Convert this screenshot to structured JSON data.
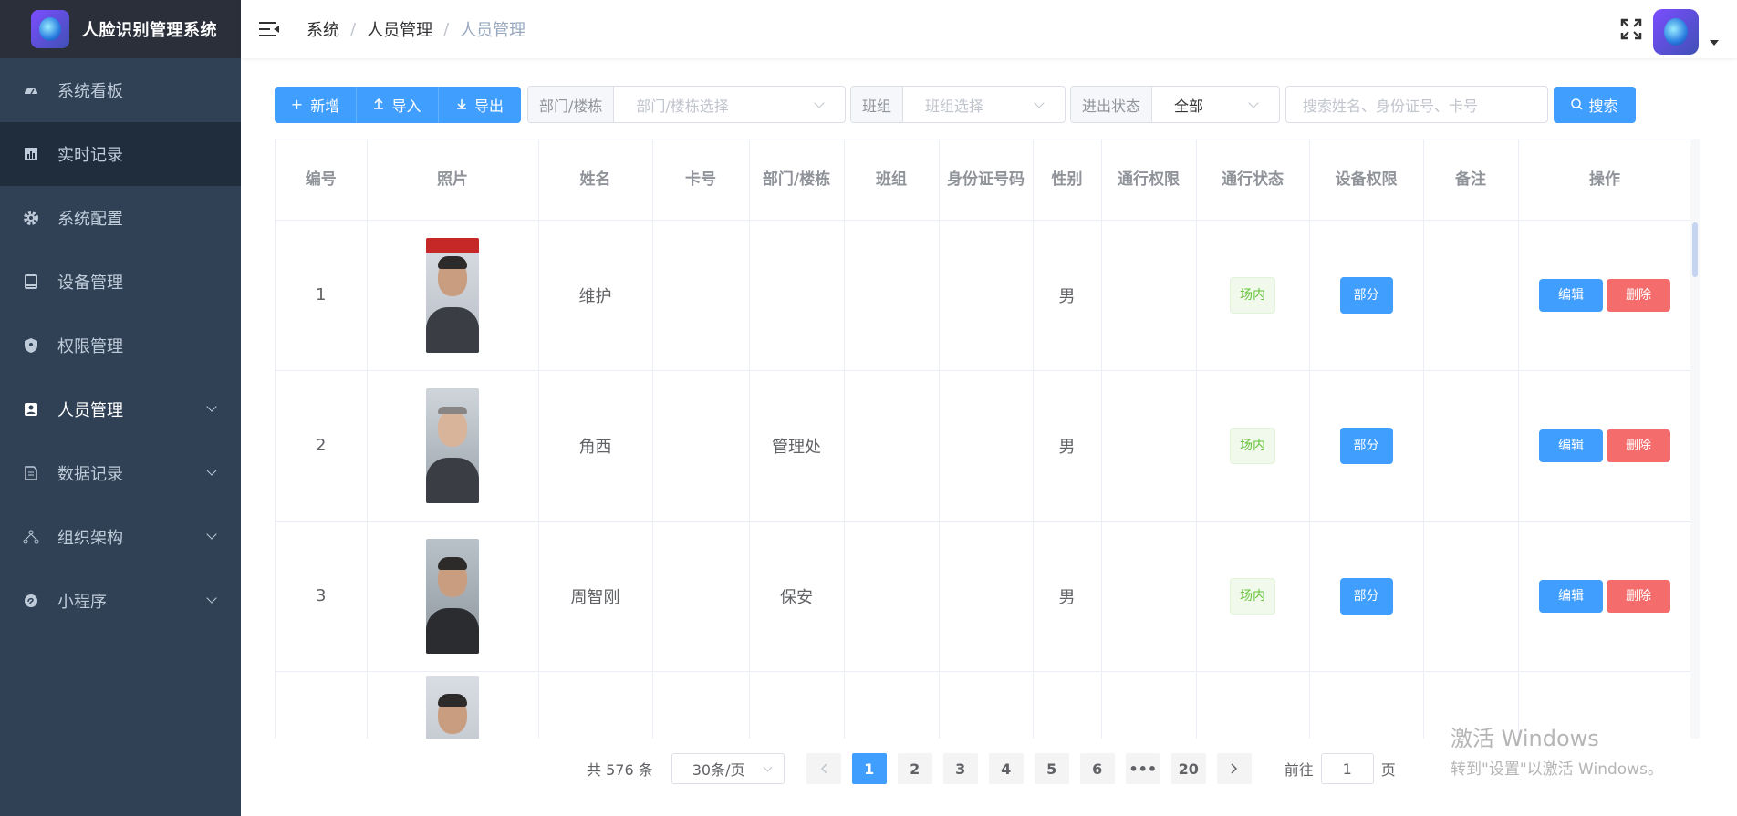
{
  "app": {
    "title": "人脸识别管理系统"
  },
  "sidebar": {
    "items": [
      {
        "label": "系统看板",
        "icon": "dashboard-icon",
        "expandable": false
      },
      {
        "label": "实时记录",
        "icon": "chart-icon",
        "expandable": false
      },
      {
        "label": "系统配置",
        "icon": "gear-icon",
        "expandable": false
      },
      {
        "label": "设备管理",
        "icon": "device-icon",
        "expandable": false
      },
      {
        "label": "权限管理",
        "icon": "shield-icon",
        "expandable": false
      },
      {
        "label": "人员管理",
        "icon": "person-card-icon",
        "expandable": true
      },
      {
        "label": "数据记录",
        "icon": "document-icon",
        "expandable": true
      },
      {
        "label": "组织架构",
        "icon": "org-icon",
        "expandable": true
      },
      {
        "label": "小程序",
        "icon": "miniapp-icon",
        "expandable": true
      }
    ]
  },
  "header": {
    "breadcrumb": [
      "系统",
      "人员管理",
      "人员管理"
    ]
  },
  "toolbar": {
    "add_label": "新增",
    "import_label": "导入",
    "export_label": "导出",
    "dept_label": "部门/楼栋",
    "dept_placeholder": "部门/楼栋选择",
    "team_label": "班组",
    "team_placeholder": "班组选择",
    "status_label": "进出状态",
    "status_value": "全部",
    "search_placeholder": "搜索姓名、身份证号、卡号",
    "search_label": "搜索"
  },
  "table": {
    "headers": [
      "编号",
      "照片",
      "姓名",
      "卡号",
      "部门/楼栋",
      "班组",
      "身份证号码",
      "性别",
      "通行权限",
      "通行状态",
      "设备权限",
      "备注",
      "操作"
    ],
    "rows": [
      {
        "id": "1",
        "name": "维护",
        "card": "",
        "dept": "",
        "team": "",
        "idno": "",
        "gender": "男",
        "access": "",
        "status": "场内",
        "device": "部分",
        "note": "",
        "edit": "编辑",
        "delete": "删除"
      },
      {
        "id": "2",
        "name": "角西",
        "card": "",
        "dept": "管理处",
        "team": "",
        "idno": "",
        "gender": "男",
        "access": "",
        "status": "场内",
        "device": "部分",
        "note": "",
        "edit": "编辑",
        "delete": "删除"
      },
      {
        "id": "3",
        "name": "周智刚",
        "card": "",
        "dept": "保安",
        "team": "",
        "idno": "",
        "gender": "男",
        "access": "",
        "status": "场内",
        "device": "部分",
        "note": "",
        "edit": "编辑",
        "delete": "删除"
      }
    ]
  },
  "pagination": {
    "total": "共 576 条",
    "page_size": "30条/页",
    "pages": [
      "1",
      "2",
      "3",
      "4",
      "5",
      "6",
      "•••",
      "20"
    ],
    "current": "1",
    "goto_prefix": "前往",
    "goto_value": "1",
    "goto_suffix": "页"
  },
  "watermark": {
    "line1": "激活 Windows",
    "line2": "转到\"设置\"以激活 Windows。"
  },
  "colors": {
    "primary": "#409eff",
    "danger": "#f56c6c",
    "success": "#67c23a",
    "sidebar": "#304156"
  }
}
